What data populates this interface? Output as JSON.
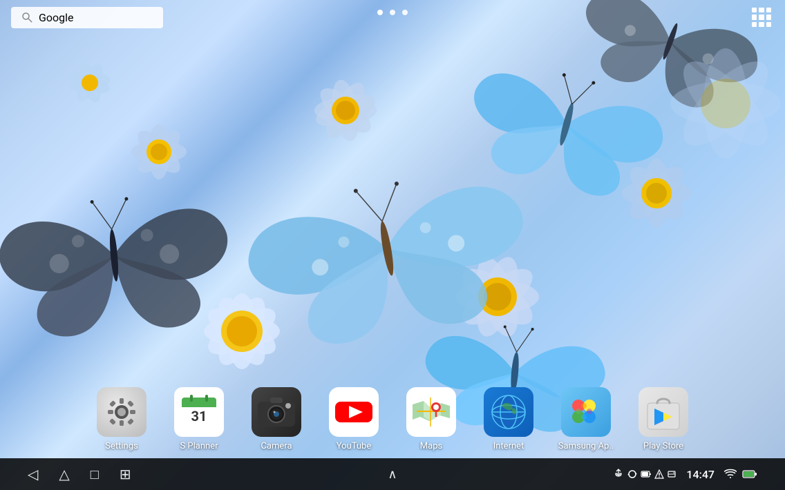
{
  "background": {
    "description": "Blue butterfly flowers wallpaper"
  },
  "topbar": {
    "search_placeholder": "Google",
    "search_icon": "search-icon"
  },
  "dots": {
    "items": [
      {
        "active": true
      },
      {
        "active": false
      },
      {
        "active": false
      }
    ]
  },
  "apps_grid_icon": "apps-grid-icon",
  "dock": {
    "apps": [
      {
        "id": "settings",
        "label": "Settings"
      },
      {
        "id": "splanner",
        "label": "S Planner"
      },
      {
        "id": "camera",
        "label": "Camera"
      },
      {
        "id": "youtube",
        "label": "YouTube"
      },
      {
        "id": "maps",
        "label": "Maps"
      },
      {
        "id": "internet",
        "label": "Internet"
      },
      {
        "id": "samsung",
        "label": "Samsung Ap.."
      },
      {
        "id": "playstore",
        "label": "Play Store"
      }
    ]
  },
  "navbar": {
    "back_icon": "◁",
    "home_icon": "△",
    "recents_icon": "□",
    "menu_icon": "⊞",
    "up_icon": "∧",
    "time": "14:47",
    "status": {
      "usb": "⚡",
      "recycle": "♻",
      "battery": "🔋",
      "warning": "⚠",
      "storage": "💾",
      "wifi": "📶",
      "battery_full": "▮"
    }
  }
}
